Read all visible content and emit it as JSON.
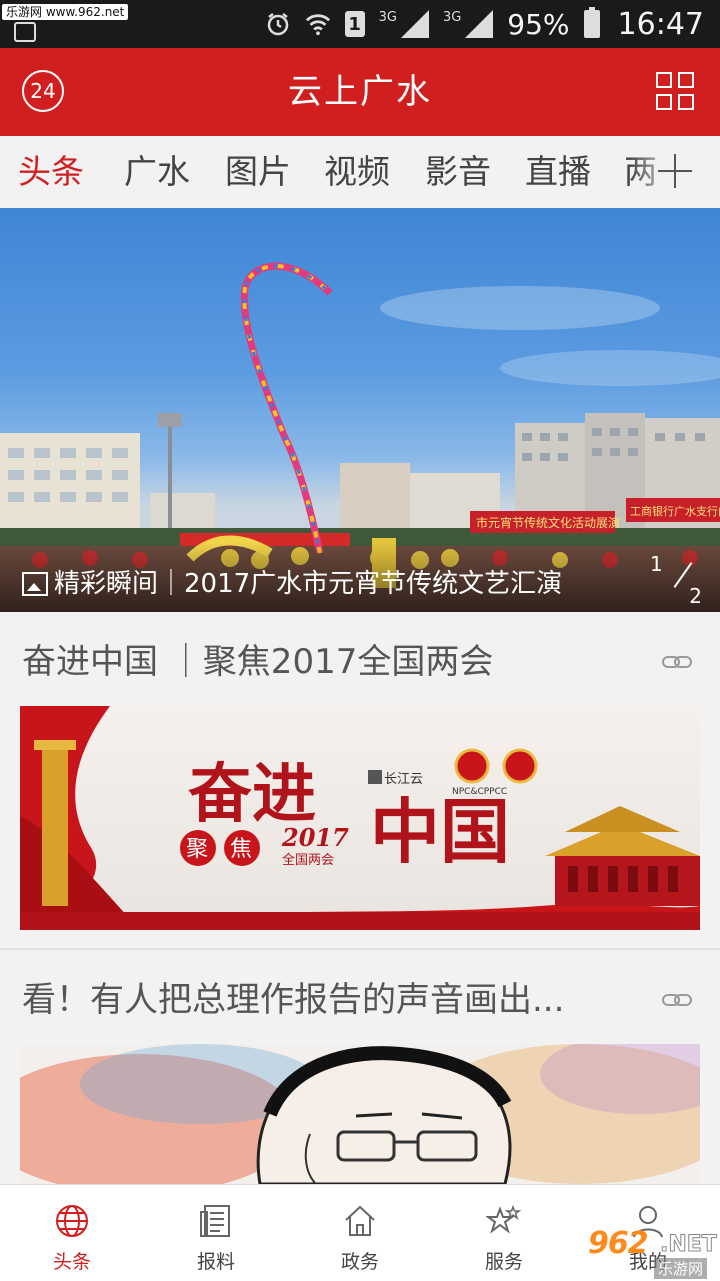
{
  "status_bar": {
    "watermark_badge": "乐游网 www.962.net",
    "battery": "95%",
    "time": "16:47",
    "sim_slot": "1",
    "network_1": "3G",
    "network_2": "3G",
    "icons": [
      "gallery-icon",
      "alarm-icon",
      "wifi-icon",
      "sim-icon",
      "signal-icon",
      "battery-icon"
    ]
  },
  "header": {
    "badge": "24",
    "title": "云上广水",
    "menu_icon": "grid-icon",
    "bg_color": "#d11f1f"
  },
  "tabs": [
    {
      "label": "头条",
      "active": true
    },
    {
      "label": "广水",
      "active": false
    },
    {
      "label": "图片",
      "active": false
    },
    {
      "label": "视频",
      "active": false
    },
    {
      "label": "影音",
      "active": false
    },
    {
      "label": "直播",
      "active": false
    },
    {
      "label": "两",
      "active": false
    }
  ],
  "hero": {
    "caption": "精彩瞬间｜2017广水市元宵节传统文艺汇演",
    "current": "1",
    "total": "2",
    "banner_texts": [
      "市元宵节传统文化活动展演",
      "工商银行广水支行向全"
    ]
  },
  "articles": [
    {
      "title": "奋进中国 ｜聚焦2017全国两会",
      "image": {
        "big_text": "奋进",
        "big_text_2": "中国",
        "badge_chars": [
          "聚",
          "焦"
        ],
        "year": "2017",
        "sub": "全国两会",
        "logo": "长江云",
        "emblem_caption": "NPC&CPPCC"
      }
    },
    {
      "title": "看！有人把总理作报告的声音画出..."
    }
  ],
  "bottom_nav": [
    {
      "label": "头条",
      "icon": "globe-icon",
      "active": true
    },
    {
      "label": "报料",
      "icon": "document-icon",
      "active": false
    },
    {
      "label": "政务",
      "icon": "home-icon",
      "active": false
    },
    {
      "label": "服务",
      "icon": "star-icon",
      "active": false
    },
    {
      "label": "我的",
      "icon": "user-icon",
      "active": false
    }
  ],
  "watermark": {
    "brand": "962",
    "suffix": ".NET",
    "sub": "乐游网"
  }
}
